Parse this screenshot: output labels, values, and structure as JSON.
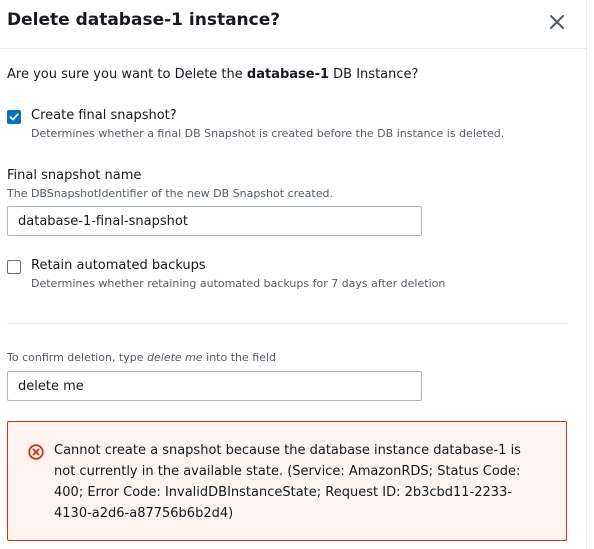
{
  "dialog": {
    "title": "Delete database-1 instance?",
    "close_icon": "close-icon"
  },
  "question": {
    "prefix": "Are you sure you want to Delete the ",
    "db_name": "database-1",
    "suffix": " DB Instance?"
  },
  "final_snapshot_option": {
    "checked": true,
    "label": "Create final snapshot?",
    "description": "Determines whether a final DB Snapshot is created before the DB instance is deleted."
  },
  "snapshot_name": {
    "label": "Final snapshot name",
    "description": "The DBSnapshotIdentifier of the new DB Snapshot created.",
    "value": "database-1-final-snapshot"
  },
  "retain_backups_option": {
    "checked": false,
    "label": "Retain automated backups",
    "description": "Determines whether retaining automated backups for 7 days after deletion"
  },
  "confirm_field": {
    "hint_prefix": "To confirm deletion, type ",
    "hint_keyword": "delete me",
    "hint_suffix": " into the field",
    "value": "delete me"
  },
  "error": {
    "icon": "error-icon",
    "message": "Cannot create a snapshot because the database instance database-1 is not currently in the available state. (Service: AmazonRDS; Status Code: 400; Error Code: InvalidDBInstanceState; Request ID: 2b3cbd11-2233-4130-a2d6-a87756b6b2d4)"
  },
  "colors": {
    "accent": "#0073bb",
    "error_border": "#d13212",
    "error_background": "#fdf3f1",
    "error_icon": "#d13212"
  }
}
